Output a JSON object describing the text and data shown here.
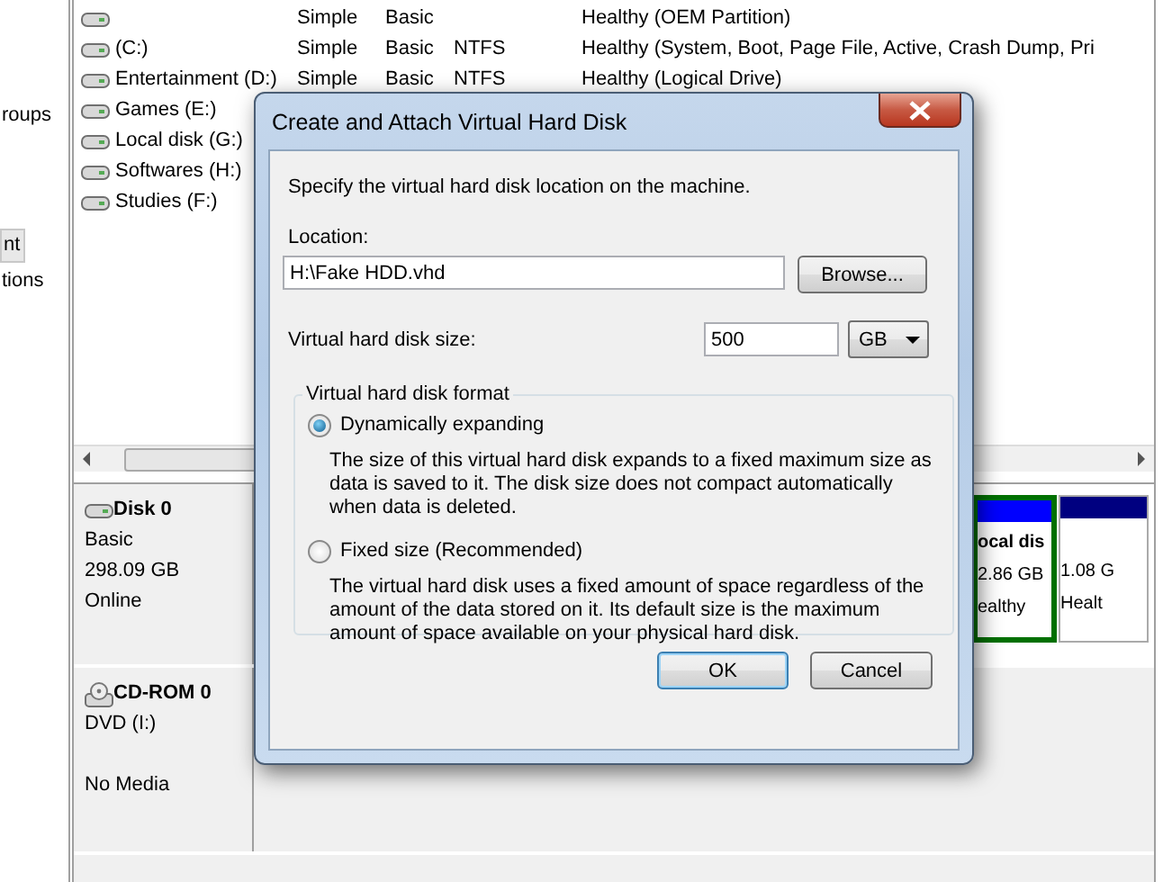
{
  "sidebar": {
    "items": [
      {
        "label": "roups",
        "selected": false
      },
      {
        "label": "nt",
        "selected": true
      },
      {
        "label": "tions",
        "selected": false
      }
    ]
  },
  "volumes": {
    "rows": [
      {
        "layout": "Simple",
        "type": "Basic",
        "status": "Healthy (OEM Partition)"
      },
      {
        "name": "(C:)",
        "layout": "Simple",
        "type": "Basic",
        "file_system": "NTFS",
        "status": "Healthy (System, Boot, Page File, Active, Crash Dump, Pri"
      },
      {
        "name": "Entertainment (D:)",
        "layout": "Simple",
        "type": "Basic",
        "file_system": "NTFS",
        "status": "Healthy (Logical Drive)"
      },
      {
        "name": "Games (E:)"
      },
      {
        "name": "Local disk (G:)"
      },
      {
        "name": "Softwares (H:)"
      },
      {
        "name": "Studies (F:)"
      }
    ]
  },
  "disks": [
    {
      "kind": "disk",
      "name": "Disk 0",
      "type": "Basic",
      "size": "298.09 GB",
      "status": "Online",
      "partitions": [
        {
          "name": "ocal dis",
          "size": "2.86 GB",
          "status": "ealthy",
          "color": "#0000ff",
          "selected": true
        },
        {
          "size": "1.08 G",
          "status": "Healt",
          "color": "#000080",
          "selected": false
        }
      ]
    },
    {
      "kind": "cdrom",
      "name": "CD-ROM 0",
      "type": "DVD (I:)",
      "status": "No Media"
    }
  ],
  "dialog": {
    "title": "Create and Attach Virtual Hard Disk",
    "instruction": "Specify the virtual hard disk location on the machine.",
    "location_label": "Location:",
    "location_value": "H:\\Fake HDD.vhd",
    "browse_button": "Browse...",
    "size_label": "Virtual hard disk size:",
    "size_value": "500",
    "size_unit": "GB",
    "format_group": "Virtual hard disk format",
    "options": [
      {
        "label": "Dynamically expanding",
        "description": "The size of this virtual hard disk expands to a fixed maximum size as data is saved to it.  The disk size does not compact automatically when data is deleted.",
        "selected": true
      },
      {
        "label": "Fixed size (Recommended)",
        "description": "The virtual hard disk uses a fixed amount of space regardless of the amount of the data stored on it.  Its default size is the maximum amount of space available on your physical hard disk.",
        "selected": false
      }
    ],
    "buttons": [
      {
        "label": "OK",
        "default": true
      },
      {
        "label": "Cancel",
        "default": false
      }
    ]
  }
}
